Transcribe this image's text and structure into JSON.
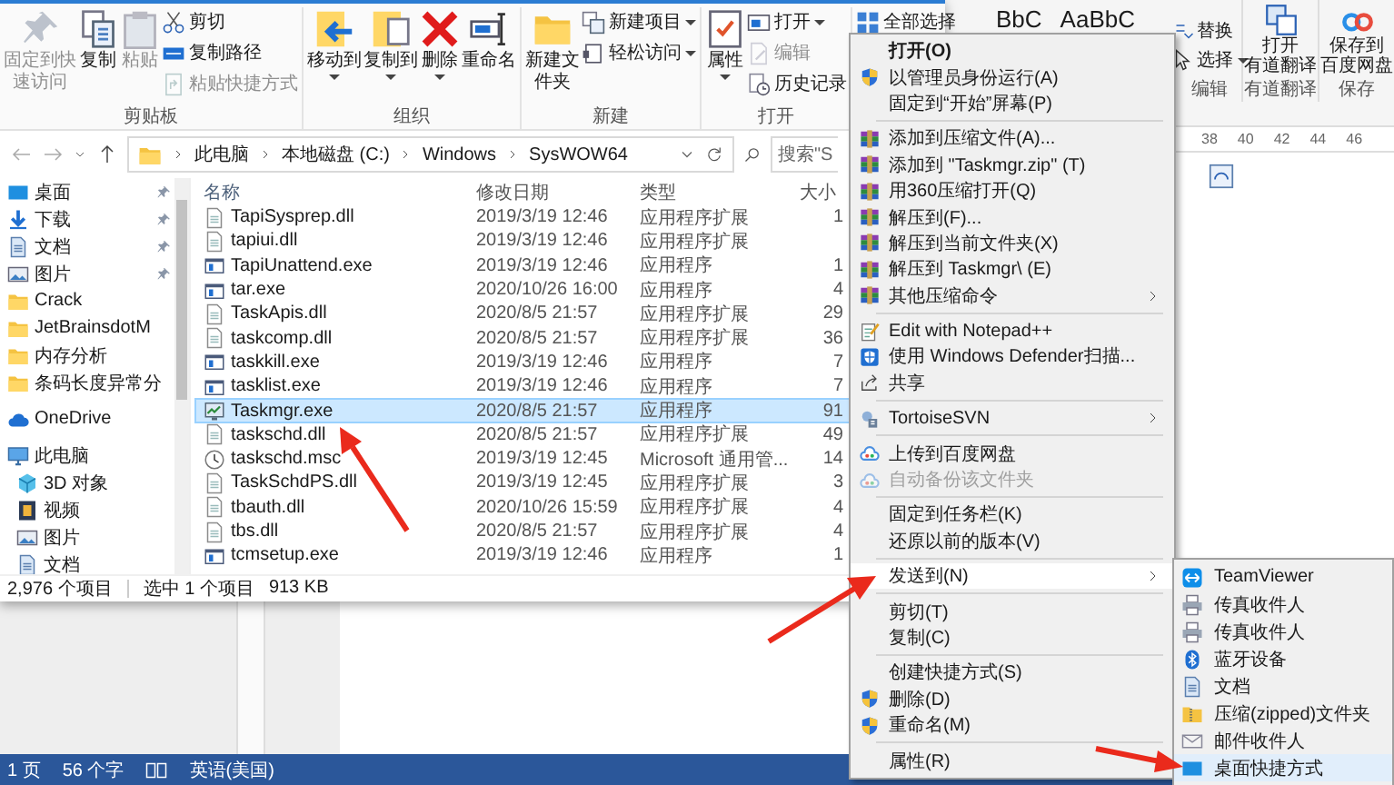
{
  "word": {
    "styles": [
      "BbC",
      "AaBbC"
    ],
    "edit_group": {
      "label": "编辑",
      "buttons": [
        {
          "label": "替换",
          "dropdown": false
        },
        {
          "label": "选择",
          "dropdown": true
        }
      ]
    },
    "youdao_group": {
      "label": "有道翻译",
      "button_lines": [
        "打开",
        "有道翻译"
      ]
    },
    "save_group": {
      "label": "保存",
      "button_lines": [
        "保存到",
        "百度网盘"
      ]
    },
    "ruler": [
      "38",
      "40",
      "42",
      "44",
      "46"
    ],
    "status_bar": {
      "page": "1 页",
      "words": "56 个字",
      "language": "英语(美国)"
    }
  },
  "explorer": {
    "ribbon": {
      "groups": [
        {
          "label": "剪贴板",
          "buttons": [
            {
              "label": "固定到快速访问",
              "kind": "large",
              "disabled": true,
              "dropdown": false
            },
            {
              "label": "复制",
              "kind": "large",
              "disabled": false,
              "dropdown": false
            },
            {
              "label": "粘贴",
              "kind": "large",
              "disabled": true,
              "dropdown": false
            },
            {
              "label": "剪切",
              "kind": "small",
              "disabled": false,
              "dropdown": false
            },
            {
              "label": "复制路径",
              "kind": "small",
              "disabled": false,
              "dropdown": false
            },
            {
              "label": "粘贴快捷方式",
              "kind": "small",
              "disabled": true,
              "dropdown": false
            }
          ]
        },
        {
          "label": "组织",
          "buttons": [
            {
              "label": "移动到",
              "kind": "large",
              "disabled": false,
              "dropdown": true
            },
            {
              "label": "复制到",
              "kind": "large",
              "disabled": false,
              "dropdown": true
            },
            {
              "label": "删除",
              "kind": "large",
              "disabled": false,
              "dropdown": true
            },
            {
              "label": "重命名",
              "kind": "large",
              "disabled": false,
              "dropdown": false
            }
          ]
        },
        {
          "label": "新建",
          "buttons": [
            {
              "label": "新建文件夹",
              "kind": "large",
              "disabled": false,
              "dropdown": false
            },
            {
              "label": "新建项目",
              "kind": "small",
              "disabled": false,
              "dropdown": true
            },
            {
              "label": "轻松访问",
              "kind": "small",
              "disabled": false,
              "dropdown": true
            }
          ]
        },
        {
          "label": "打开",
          "buttons": [
            {
              "label": "属性",
              "kind": "large",
              "disabled": false,
              "dropdown": true
            },
            {
              "label": "打开",
              "kind": "small",
              "disabled": false,
              "dropdown": true
            },
            {
              "label": "编辑",
              "kind": "small",
              "disabled": true,
              "dropdown": false
            },
            {
              "label": "历史记录",
              "kind": "small",
              "disabled": false,
              "dropdown": false
            }
          ]
        },
        {
          "buttons": [
            {
              "label": "全部选择",
              "kind": "small",
              "disabled": false,
              "dropdown": false
            }
          ]
        }
      ]
    },
    "address": {
      "crumbs": [
        "此电脑",
        "本地磁盘 (C:)",
        "Windows",
        "SysWOW64"
      ]
    },
    "search": {
      "placeholder": "搜索\"S"
    },
    "nav": {
      "items": [
        {
          "label": "桌面",
          "pinned": true
        },
        {
          "label": "下载",
          "pinned": true
        },
        {
          "label": "文档",
          "pinned": true
        },
        {
          "label": "图片",
          "pinned": true
        },
        {
          "label": "Crack",
          "pinned": false
        },
        {
          "label": "JetBrainsdotM",
          "pinned": false
        },
        {
          "label": "内存分析",
          "pinned": false
        },
        {
          "label": "条码长度异常分",
          "pinned": false
        },
        {
          "label": "OneDrive",
          "pinned": false
        },
        {
          "label": "此电脑",
          "pinned": false,
          "children": [
            {
              "label": "3D 对象",
              "pinned": false
            },
            {
              "label": "视频",
              "pinned": false
            },
            {
              "label": "图片",
              "pinned": false
            },
            {
              "label": "文档",
              "pinned": false
            }
          ]
        }
      ]
    },
    "files": {
      "columns": [
        "名称",
        "修改日期",
        "类型",
        "大小"
      ],
      "rows": [
        {
          "name": "TapiSysprep.dll",
          "date": "2019/3/19 12:46",
          "type": "应用程序扩展",
          "size": "1",
          "selected": false
        },
        {
          "name": "tapiui.dll",
          "date": "2019/3/19 12:46",
          "type": "应用程序扩展",
          "selected": false
        },
        {
          "name": "TapiUnattend.exe",
          "date": "2019/3/19 12:46",
          "type": "应用程序",
          "size": "1",
          "selected": false
        },
        {
          "name": "tar.exe",
          "date": "2020/10/26 16:00",
          "type": "应用程序",
          "size": "4",
          "selected": false
        },
        {
          "name": "TaskApis.dll",
          "date": "2020/8/5 21:57",
          "type": "应用程序扩展",
          "size": "29",
          "selected": false
        },
        {
          "name": "taskcomp.dll",
          "date": "2020/8/5 21:57",
          "type": "应用程序扩展",
          "size": "36",
          "selected": false
        },
        {
          "name": "taskkill.exe",
          "date": "2019/3/19 12:46",
          "type": "应用程序",
          "size": "7",
          "selected": false
        },
        {
          "name": "tasklist.exe",
          "date": "2019/3/19 12:46",
          "type": "应用程序",
          "size": "7",
          "selected": false
        },
        {
          "name": "Taskmgr.exe",
          "date": "2020/8/5 21:57",
          "type": "应用程序",
          "size": "91",
          "selected": true
        },
        {
          "name": "taskschd.dll",
          "date": "2020/8/5 21:57",
          "type": "应用程序扩展",
          "size": "49",
          "selected": false
        },
        {
          "name": "taskschd.msc",
          "date": "2019/3/19 12:45",
          "type": "Microsoft 通用管...",
          "size": "14",
          "selected": false
        },
        {
          "name": "TaskSchdPS.dll",
          "date": "2019/3/19 12:45",
          "type": "应用程序扩展",
          "size": "3",
          "selected": false
        },
        {
          "name": "tbauth.dll",
          "date": "2020/10/26 15:59",
          "type": "应用程序扩展",
          "size": "4",
          "selected": false
        },
        {
          "name": "tbs.dll",
          "date": "2020/8/5 21:57",
          "type": "应用程序扩展",
          "size": "4",
          "selected": false
        },
        {
          "name": "tcmsetup.exe",
          "date": "2019/3/19 12:46",
          "type": "应用程序",
          "size": "1",
          "selected": false
        }
      ]
    },
    "status_bar": {
      "count": "2,976 个项目",
      "selection": "选中 1 个项目",
      "size": "913 KB"
    }
  },
  "context_menu": {
    "groups": [
      {
        "items": [
          {
            "label": "打开(O)",
            "default": true,
            "disabled": false,
            "submenu": false,
            "selected": false
          },
          {
            "label": "以管理员身份运行(A)",
            "default": false,
            "disabled": false,
            "submenu": false,
            "selected": false
          },
          {
            "label": "固定到“开始”屏幕(P)",
            "default": false,
            "disabled": false,
            "submenu": false,
            "selected": false
          }
        ]
      },
      {
        "items": [
          {
            "label": "添加到压缩文件(A)...",
            "default": false,
            "disabled": false,
            "submenu": false,
            "selected": false
          },
          {
            "label": "添加到 \"Taskmgr.zip\" (T)",
            "default": false,
            "disabled": false,
            "submenu": false,
            "selected": false
          },
          {
            "label": "用360压缩打开(Q)",
            "default": false,
            "disabled": false,
            "submenu": false,
            "selected": false
          },
          {
            "label": "解压到(F)...",
            "default": false,
            "disabled": false,
            "submenu": false,
            "selected": false
          },
          {
            "label": "解压到当前文件夹(X)",
            "default": false,
            "disabled": false,
            "submenu": false,
            "selected": false
          },
          {
            "label": "解压到 Taskmgr\\ (E)",
            "default": false,
            "disabled": false,
            "submenu": false,
            "selected": false
          },
          {
            "label": "其他压缩命令",
            "default": false,
            "disabled": false,
            "submenu": true,
            "selected": false
          }
        ]
      },
      {
        "items": [
          {
            "label": "Edit with Notepad++",
            "default": false,
            "disabled": false,
            "submenu": false,
            "selected": false
          },
          {
            "label": "使用 Windows Defender扫描...",
            "default": false,
            "disabled": false,
            "submenu": false,
            "selected": false
          },
          {
            "label": "共享",
            "default": false,
            "disabled": false,
            "submenu": false,
            "selected": false
          }
        ]
      },
      {
        "items": [
          {
            "label": "TortoiseSVN",
            "default": false,
            "disabled": false,
            "submenu": true,
            "selected": false
          }
        ]
      },
      {
        "items": [
          {
            "label": "上传到百度网盘",
            "default": false,
            "disabled": false,
            "submenu": false,
            "selected": false
          },
          {
            "label": "自动备份该文件夹",
            "default": false,
            "disabled": true,
            "submenu": false,
            "selected": false
          }
        ]
      },
      {
        "items": [
          {
            "label": "固定到任务栏(K)",
            "default": false,
            "disabled": false,
            "submenu": false,
            "selected": false
          },
          {
            "label": "还原以前的版本(V)",
            "default": false,
            "disabled": false,
            "submenu": false,
            "selected": false
          }
        ]
      },
      {
        "items": [
          {
            "label": "发送到(N)",
            "default": false,
            "disabled": false,
            "submenu": true,
            "selected": true
          }
        ]
      },
      {
        "items": [
          {
            "label": "剪切(T)",
            "default": false,
            "disabled": false,
            "submenu": false,
            "selected": false
          },
          {
            "label": "复制(C)",
            "default": false,
            "disabled": false,
            "submenu": false,
            "selected": false
          }
        ]
      },
      {
        "items": [
          {
            "label": "创建快捷方式(S)",
            "default": false,
            "disabled": false,
            "submenu": false,
            "selected": false
          },
          {
            "label": "删除(D)",
            "default": false,
            "disabled": false,
            "submenu": false,
            "selected": false
          },
          {
            "label": "重命名(M)",
            "default": false,
            "disabled": false,
            "submenu": false,
            "selected": false
          }
        ]
      },
      {
        "items": [
          {
            "label": "属性(R)",
            "default": false,
            "disabled": false,
            "submenu": false,
            "selected": false
          }
        ]
      }
    ]
  },
  "send_to_menu": {
    "items": [
      {
        "label": "TeamViewer",
        "selected": false
      },
      {
        "label": "传真收件人",
        "selected": false
      },
      {
        "label": "传真收件人",
        "selected": false
      },
      {
        "label": "蓝牙设备",
        "selected": false
      },
      {
        "label": "文档",
        "selected": false
      },
      {
        "label": "压缩(zipped)文件夹",
        "selected": false
      },
      {
        "label": "邮件收件人",
        "selected": false
      },
      {
        "label": "桌面快捷方式",
        "selected": true
      }
    ]
  }
}
